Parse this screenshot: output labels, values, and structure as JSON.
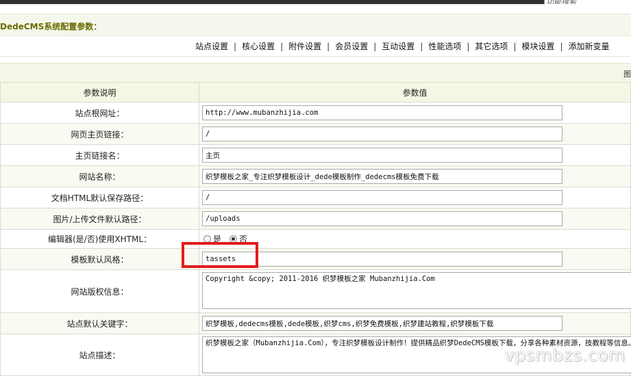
{
  "top": {
    "search_text": "功能搜索"
  },
  "page_title": "DedeCMS系统配置参数：",
  "tabs": [
    "站点设置",
    "核心设置",
    "附件设置",
    "会员设置",
    "互动设置",
    "性能选项",
    "其它选项",
    "模块设置",
    "添加新变量"
  ],
  "section_edge_text": "图",
  "table": {
    "headers": {
      "desc": "参数说明",
      "value": "参数值"
    },
    "rows": [
      {
        "label": "站点根网址：",
        "value": "http://www.mubanzhijia.com"
      },
      {
        "label": "网页主页链接：",
        "value": "/"
      },
      {
        "label": "主页链接名：",
        "value": "主页"
      },
      {
        "label": "网站名称：",
        "value": "织梦模板之家_专注织梦模板设计_dede模板制作_dedecms模板免费下载"
      },
      {
        "label": "文档HTML默认保存路径：",
        "value": "/"
      },
      {
        "label": "图片/上传文件默认路径：",
        "value": "/uploads"
      },
      {
        "label": "编辑器(是/否)使用XHTML：",
        "options": [
          "是",
          "否"
        ],
        "selected": "否"
      },
      {
        "label": "模板默认风格：",
        "value": "tassets"
      },
      {
        "label": "网站版权信息：",
        "value": "Copyright &copy; 2011-2016 织梦模板之家 Mubanzhijia.Com"
      },
      {
        "label": "站点默认关键字：",
        "value": "织梦模板,dedecms模板,dede模板,织梦cms,织梦免费模板,织梦建站教程,织梦模板下载"
      },
      {
        "label": "站点描述：",
        "value": "织梦模板之家（Mubanzhijia.Com），专注织梦模板设计制作！提供精品织梦DedeCMS模板下载，分享各种素材资源，技教程等信息。"
      }
    ]
  },
  "watermark": "vpsmbzs.com",
  "colors": {
    "highlight": "#e31b1b",
    "title": "#6b6b00",
    "header_bg": "#f3f7e4"
  }
}
